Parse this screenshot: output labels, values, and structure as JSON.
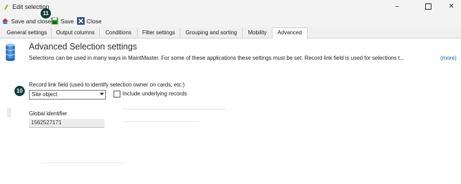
{
  "window": {
    "title": "Edit selection"
  },
  "toolbar": {
    "save_close_label": "Save and close",
    "save_label": "Save",
    "close_label": "Close"
  },
  "tabs": [
    {
      "label": "General settings"
    },
    {
      "label": "Output columns"
    },
    {
      "label": "Conditions"
    },
    {
      "label": "Filter settings"
    },
    {
      "label": "Grouping and sorting"
    },
    {
      "label": "Mobility"
    },
    {
      "label": "Advanced"
    }
  ],
  "active_tab": "Advanced",
  "main": {
    "heading": "Advanced Selection settings",
    "description": "Selections can be used in many ways in MaintMaster. For some of these applications these settings must be set. Record link field is used for selections t...",
    "more_link": "(more)",
    "record_link_label": "Record link field (used to identify selection owner on cards, etc.)",
    "record_link_value": "Site object",
    "include_underlying_label": "Include underlying records",
    "include_underlying_checked": false,
    "global_identifier_label": "Global identifier",
    "global_identifier_value": "1562527171"
  },
  "badges": {
    "b11": "11",
    "b10": "10"
  },
  "colors": {
    "badge": "#0f3d3a",
    "link": "#1a5fb4",
    "active_tab": "#ffffff"
  }
}
